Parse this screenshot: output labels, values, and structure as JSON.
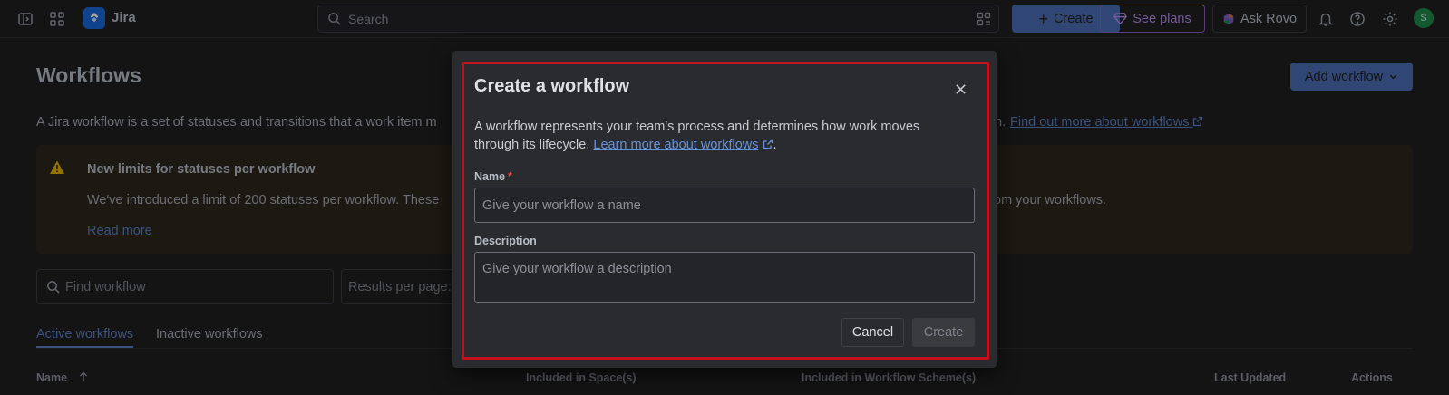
{
  "topnav": {
    "app_name": "Jira",
    "search_placeholder": "Search",
    "create_label": "Create",
    "plans_label": "See plans",
    "rovo_label": "Ask Rovo",
    "avatar_initial": "S"
  },
  "page": {
    "title": "Workflows",
    "add_button_label": "Add workflow",
    "intro_text": "A Jira workflow is a set of statuses and transitions that a work item m",
    "intro_tail": "n.",
    "intro_link": "Find out more about workflows"
  },
  "warning": {
    "title": "New limits for statuses per workflow",
    "body_start": "We've introduced a limit of 200 statuses per workflow. These",
    "body_end": "om your workflows.",
    "link": "Read more"
  },
  "filters": {
    "find_placeholder": "Find workflow",
    "results_placeholder": "Results per page:"
  },
  "tabs": {
    "active": "Active workflows",
    "inactive": "Inactive workflows"
  },
  "table": {
    "columns": [
      "Name",
      "Included in Space(s)",
      "Included in Workflow Scheme(s)",
      "Last Updated",
      "Actions"
    ]
  },
  "modal": {
    "title": "Create a workflow",
    "description": "A workflow represents your team's process and determines how work moves through its lifecycle.",
    "description_link": "Learn more about workflows",
    "description_end": ".",
    "name_label": "Name",
    "required_mark": "*",
    "name_placeholder": "Give your workflow a name",
    "description_label": "Description",
    "description_placeholder": "Give your workflow a description",
    "cancel_label": "Cancel",
    "create_label": "Create"
  },
  "colors": {
    "primary_button": "#4a6eb4",
    "link": "#5d7fbf",
    "highlight": "#c4101c",
    "warning_bg": "#2c271d",
    "warning_icon": "#e2b203"
  }
}
